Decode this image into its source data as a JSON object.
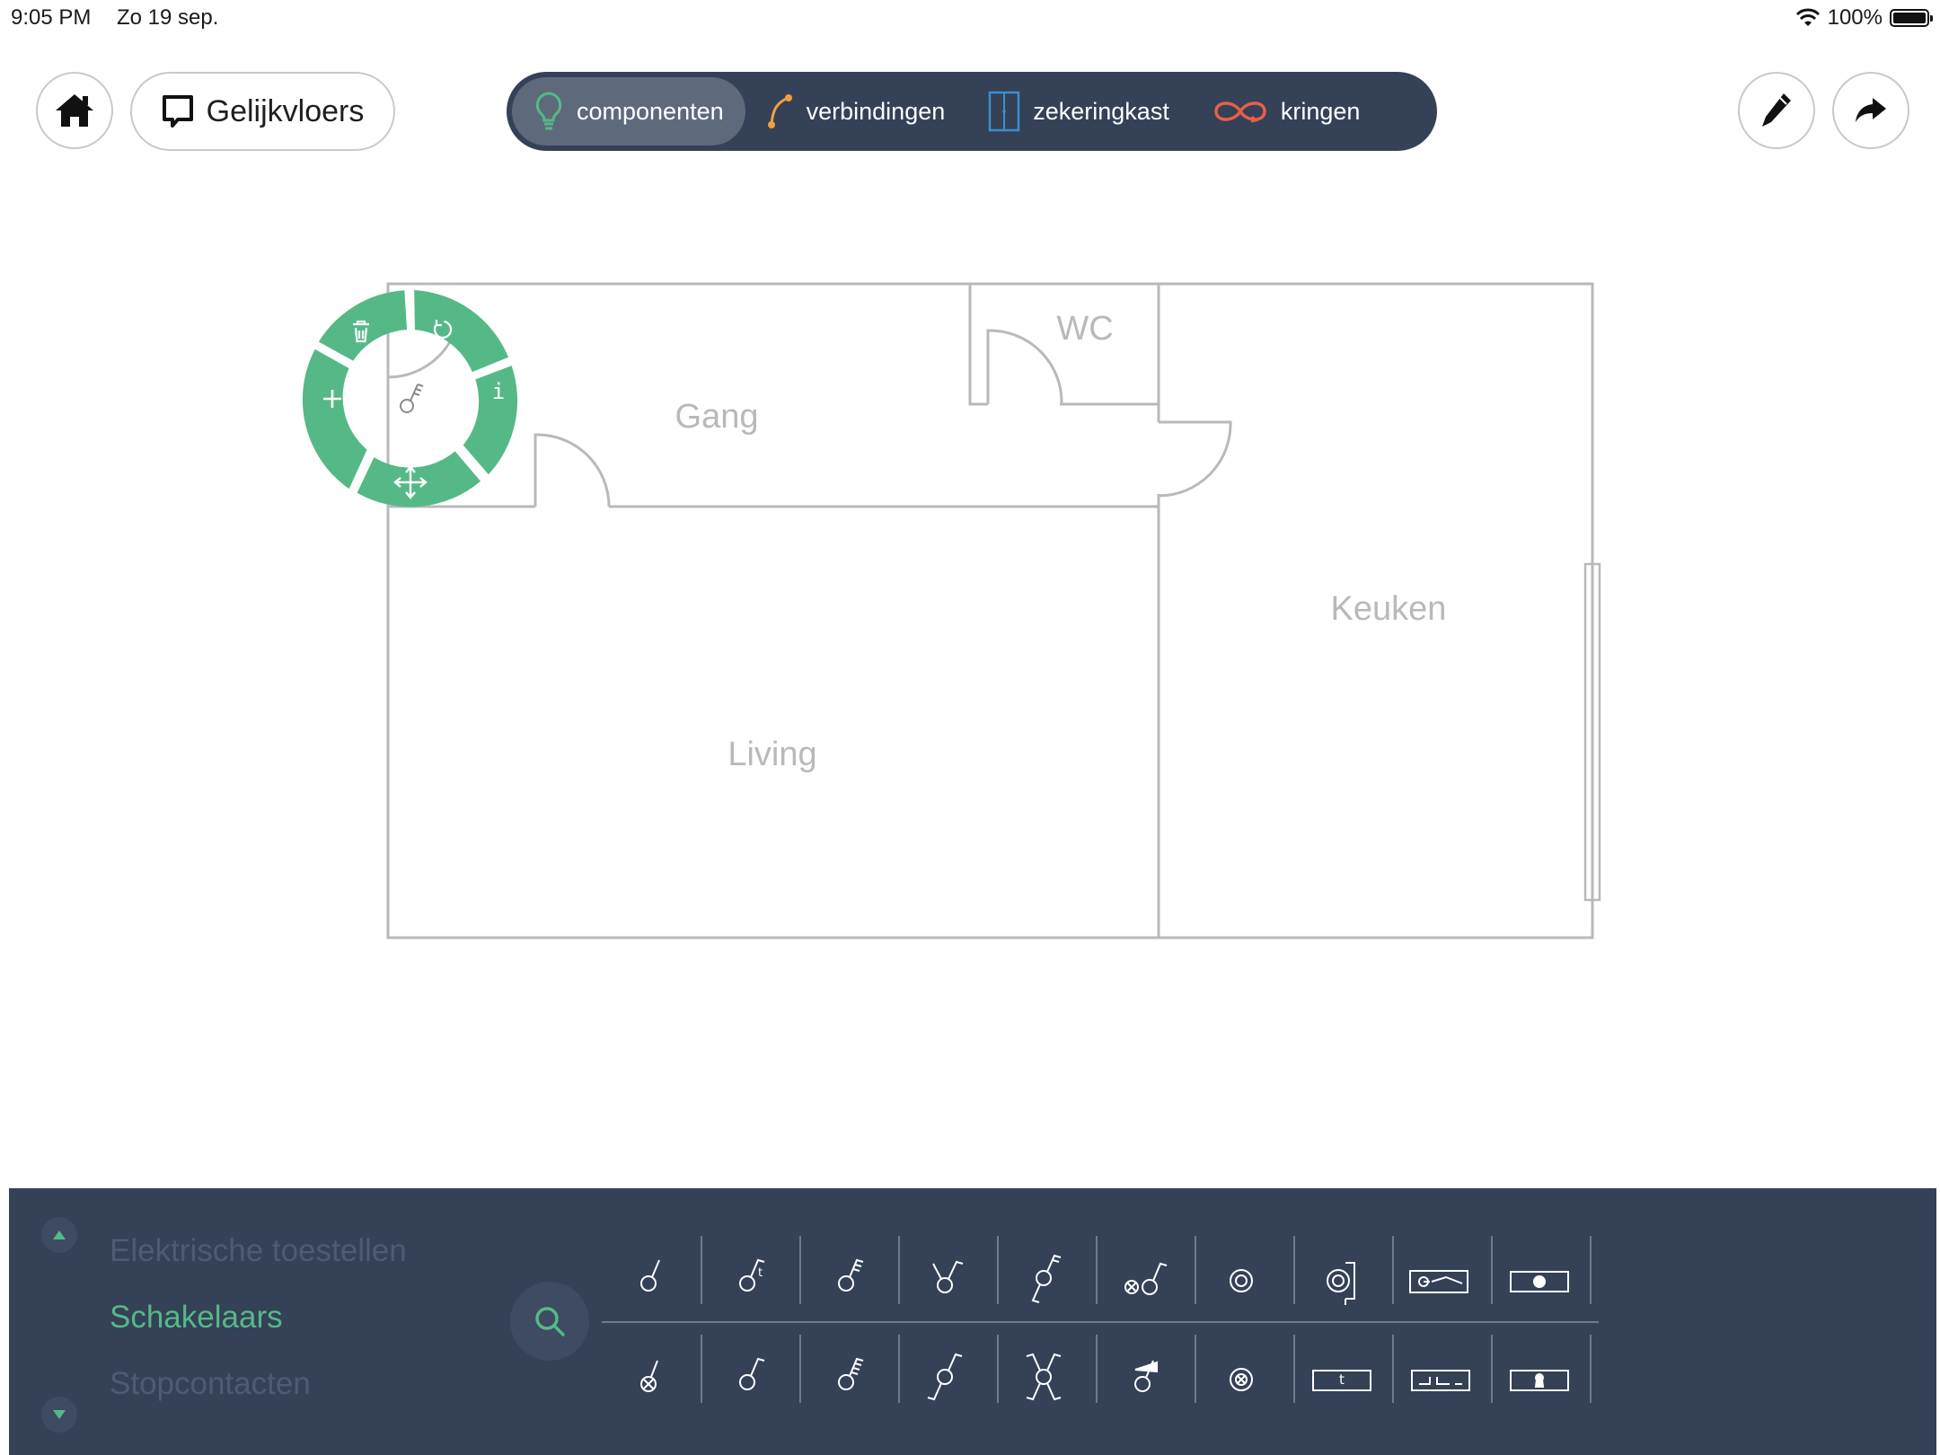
{
  "status_bar": {
    "time": "9:05 PM",
    "date": "Zo 19 sep.",
    "battery": "100%"
  },
  "toolbar": {
    "floor_label": "Gelijkvloers",
    "tabs": [
      {
        "label": "componenten",
        "icon": "bulb-icon",
        "active": true
      },
      {
        "label": "verbindingen",
        "icon": "connection-icon",
        "active": false
      },
      {
        "label": "zekeringkast",
        "icon": "fusebox-icon",
        "active": false
      },
      {
        "label": "kringen",
        "icon": "circuits-icon",
        "active": false
      }
    ]
  },
  "plan": {
    "rooms": [
      {
        "name": "Gang"
      },
      {
        "name": "WC"
      },
      {
        "name": "Keuken"
      },
      {
        "name": "Living"
      }
    ]
  },
  "radial_menu": {
    "actions": [
      "delete",
      "rotate",
      "info",
      "move",
      "add"
    ],
    "info_glyph": "i",
    "color": "#55b987"
  },
  "panel": {
    "categories": [
      {
        "label": "Elektrische toestellen",
        "active": false
      },
      {
        "label": "Schakelaars",
        "active": true
      },
      {
        "label": "Stopcontacten",
        "active": false
      }
    ],
    "symbols_row1": [
      "switch-single",
      "switch-single-t",
      "switch-double",
      "switch-double-pole",
      "switch-two-way",
      "switch-lamp",
      "pushbutton",
      "pushbutton-box",
      "timer-switch",
      "socket-dot"
    ],
    "symbols_row2": [
      "switch-lamp-x",
      "switch-plain",
      "switch-triple",
      "switch-crossover",
      "switch-cross",
      "switch-dimmer",
      "pushbutton-x",
      "box-t",
      "box-lines",
      "box-keyhole"
    ],
    "box_t_label": "t"
  },
  "colors": {
    "accent": "#55b987",
    "navy": "#344157",
    "orange": "#f29f3a",
    "red": "#e5604a",
    "blue": "#3c8ed0"
  }
}
